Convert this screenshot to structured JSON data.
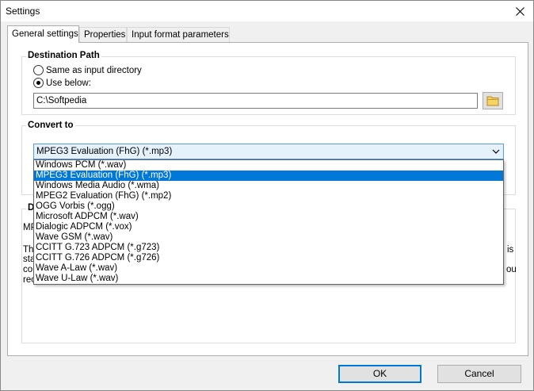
{
  "window": {
    "title": "Settings"
  },
  "tabs": [
    {
      "label": "General settings",
      "active": true
    },
    {
      "label": "Properties",
      "active": false
    },
    {
      "label": "Input format parameters",
      "active": false
    }
  ],
  "destination": {
    "title": "Destination Path",
    "option_same": "Same as input directory",
    "option_below": "Use below:",
    "selected_option": "Use below:",
    "path_value": "C:\\Softpedia"
  },
  "convert": {
    "title": "Convert to",
    "selected": "MPEG3 Evaluation (FhG)  (*.mp3)",
    "options": [
      "Windows PCM (*.wav)",
      "MPEG3 Evaluation (FhG)  (*.mp3)",
      "Windows Media Audio (*.wma)",
      "MPEG2 Evaluation (FhG)  (*.mp2)",
      "OGG Vorbis (*.ogg)",
      "Microsoft ADPCM (*.wav)",
      "Dialogic ADPCM (*.vox)",
      "Wave GSM (*.wav)",
      "CCITT G.723 ADPCM (*.g723)",
      "CCITT G.726 ADPCM (*.g726)",
      "Wave A-Law (*.wav)",
      "Wave U-Law (*.wav)"
    ],
    "highlighted_index": 1
  },
  "description": {
    "title_fragment": "D",
    "line1_left": "MP",
    "line2_left": "The",
    "line2_right": "is",
    "line3_left": "sta",
    "line4_left": "cor",
    "line4_right": "ou",
    "line5_left": "rec"
  },
  "buttons": {
    "ok": "OK",
    "cancel": "Cancel"
  },
  "colors": {
    "accent": "#0078d7",
    "selection_bg": "#0078d7",
    "combo_bg": "#e5f1fb"
  },
  "icons": {
    "close": "close-icon",
    "folder": "folder-icon",
    "dropdown": "chevron-down-icon"
  }
}
